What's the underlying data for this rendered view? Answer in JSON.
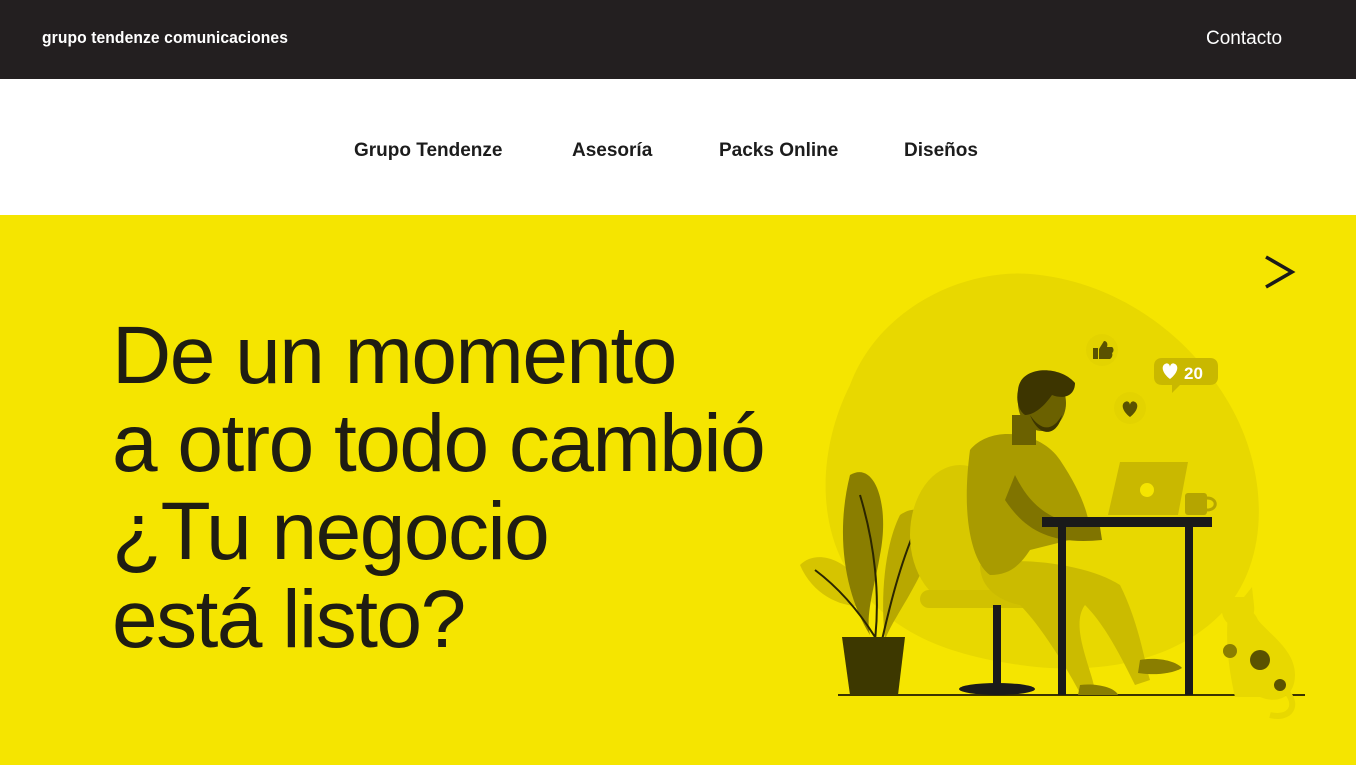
{
  "header": {
    "brand": "grupo tendenze comunicaciones",
    "contact_label": "Contacto"
  },
  "nav": {
    "items": [
      {
        "label": "Grupo Tendenze"
      },
      {
        "label": "Asesoría"
      },
      {
        "label": "Packs Online"
      },
      {
        "label": "Diseños"
      }
    ]
  },
  "hero": {
    "headline_lines": [
      "De un momento",
      "a otro todo cambió",
      "¿Tu negocio",
      "está listo?"
    ],
    "like_count": "20",
    "next_icon": "chevron-right-icon"
  },
  "colors": {
    "topbar": "#231f20",
    "hero_bg": "#f5e500",
    "text_dark": "#1f1d12"
  }
}
